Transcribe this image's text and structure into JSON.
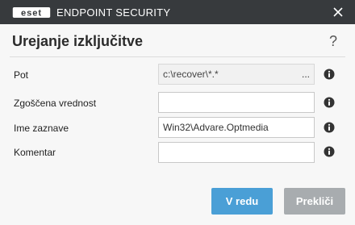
{
  "window": {
    "brand": "eset",
    "app_title": "ENDPOINT SECURITY",
    "close_icon": "close-icon"
  },
  "dialog": {
    "title": "Urejanje izključitve",
    "help": "?"
  },
  "form": {
    "path": {
      "label": "Pot",
      "value": "c:\\recover\\*.*",
      "browse": "..."
    },
    "hash": {
      "label": "Zgoščena vrednost",
      "value": ""
    },
    "name": {
      "label": "Ime zaznave",
      "value": "Win32\\Advare.Optmedia"
    },
    "comment": {
      "label": "Komentar",
      "value": ""
    }
  },
  "buttons": {
    "ok": "V redu",
    "cancel": "Prekliči"
  },
  "colors": {
    "titlebar": "#373a3d",
    "ok_button": "#4a9fd6",
    "cancel_button": "#a8acaf"
  }
}
